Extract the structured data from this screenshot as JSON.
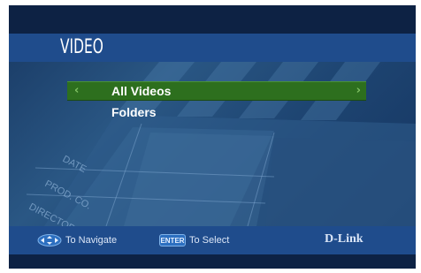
{
  "header": {
    "title": "VIDEO"
  },
  "menu": {
    "items": [
      {
        "label": "All Videos",
        "selected": true
      },
      {
        "label": "Folders",
        "selected": false
      }
    ],
    "arrow_left": "‹",
    "arrow_right": "›"
  },
  "background": {
    "clapperboard_labels": [
      "DATE",
      "PROD. CO.",
      "DIRECTOR"
    ]
  },
  "footer": {
    "navigate_hint": "To Navigate",
    "enter_key_label": "ENTER",
    "select_hint": "To Select",
    "brand": "D-Link"
  },
  "colors": {
    "header_bar": "#1f4c8c",
    "selection": "#2d6f1e",
    "text": "#ffffff"
  }
}
